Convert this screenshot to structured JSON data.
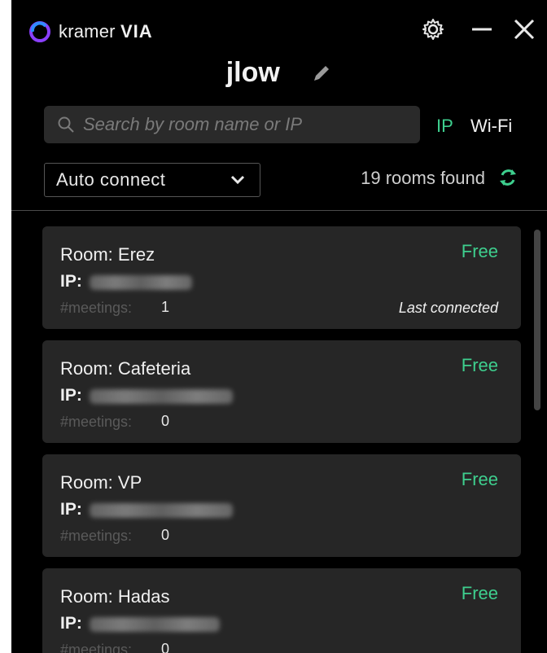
{
  "app": {
    "brand_light": "kramer",
    "brand_bold": "VIA"
  },
  "icons": {
    "logo": "kramer-logo-icon",
    "settings": "gear-icon",
    "minimize": "minimize-icon",
    "close": "close-icon",
    "edit": "pencil-icon",
    "search": "search-icon",
    "dropdown": "chevron-down-icon",
    "refresh": "refresh-icon"
  },
  "user": {
    "name": "jlow"
  },
  "search": {
    "placeholder": "Search by room name or IP",
    "value": ""
  },
  "network_tabs": [
    {
      "label": "IP",
      "active": true
    },
    {
      "label": "Wi-Fi",
      "active": false
    }
  ],
  "connect_mode": {
    "selected": "Auto connect"
  },
  "rooms_found": "19 rooms found",
  "labels": {
    "ip": "IP:",
    "meetings": "#meetings:"
  },
  "rooms": [
    {
      "name": "Room: Erez",
      "status": "Free",
      "meetings": "1",
      "note": "Last connected"
    },
    {
      "name": "Room: Cafeteria",
      "status": "Free",
      "meetings": "0",
      "note": ""
    },
    {
      "name": "Room: VP",
      "status": "Free",
      "meetings": "0",
      "note": ""
    },
    {
      "name": "Room: Hadas",
      "status": "Free",
      "meetings": "0",
      "note": ""
    }
  ],
  "colors": {
    "accent_green": "#3ecf8e",
    "background": "#000000",
    "card": "#262626",
    "logo_purple": "#8a3ffc",
    "logo_blue": "#2f8cff"
  }
}
